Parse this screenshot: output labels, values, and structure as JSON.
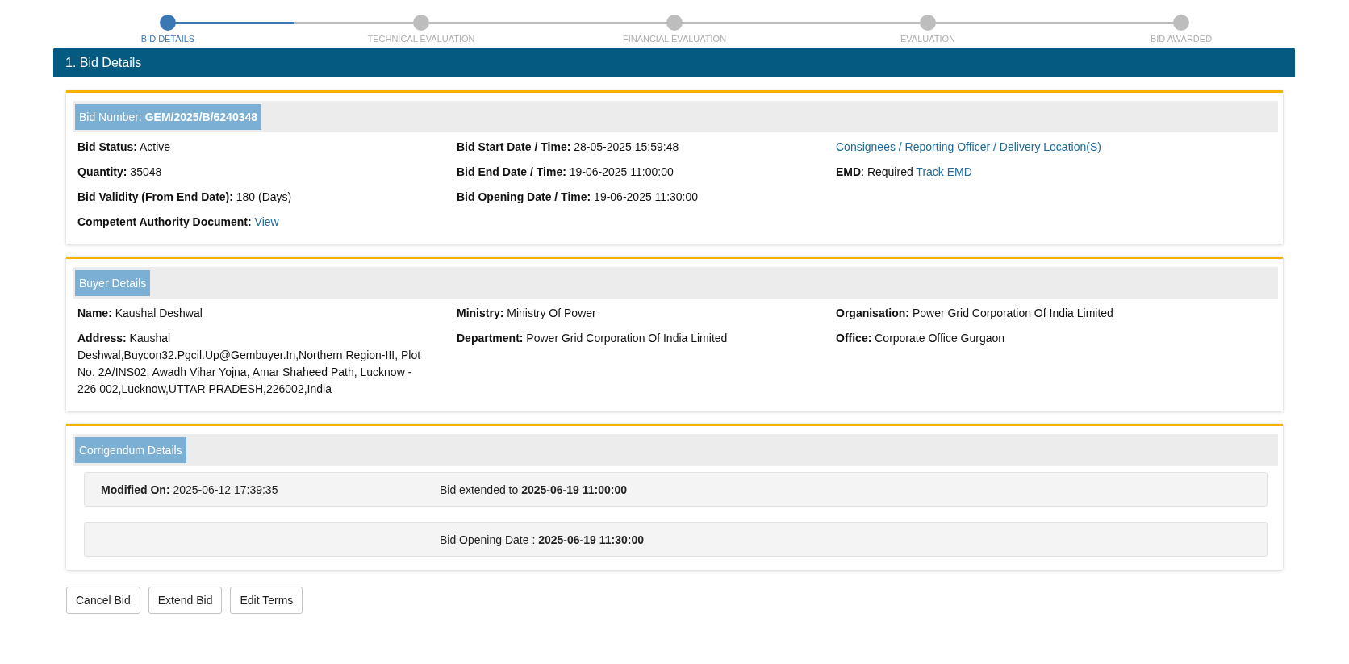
{
  "stepper": [
    {
      "label": "BID DETAILS",
      "selected": true
    },
    {
      "label": "TECHNICAL EVALUATION",
      "selected": false
    },
    {
      "label": "FINANCIAL EVALUATION",
      "selected": false
    },
    {
      "label": "EVALUATION",
      "selected": false
    },
    {
      "label": "BID AWARDED",
      "selected": false
    }
  ],
  "section_title": "1. Bid Details",
  "cards": [
    {
      "heading": "Bid Number: **GEM/2025/B/6240348**",
      "columns": [
        [
          {
            "text": "**Bid Status:** Active"
          },
          {
            "text": "**Quantity:** 35048"
          },
          {
            "text": "**Bid Validity (From End Date):** 180 (Days)"
          },
          {
            "text": "**Competent Authority Document:**",
            "link": "View"
          }
        ],
        [
          {
            "text": "**Bid Start Date / Time:** 28-05-2025 15:59:48"
          },
          {
            "text": "**Bid End Date / Time:** 19-06-2025 11:00:00"
          },
          {
            "text": "**Bid Opening Date / Time:** 19-06-2025 11:30:00"
          }
        ],
        [
          {
            "link": "Consignees / Reporting Officer / Delivery Location(S)"
          },
          {
            "text": "**EMD**: Required",
            "link": "Track EMD"
          }
        ]
      ]
    },
    {
      "heading": "Buyer Details",
      "columns": [
        [
          {
            "text": "**Name:** Kaushal Deshwal"
          },
          {
            "text": "**Address:** Kaushal Deshwal,Buycon32.Pgcil.Up@Gembuyer.In,Northern Region-III, Plot No. 2A/INS02, Awadh Vihar Yojna, Amar Shaheed Path, Lucknow - 226 002,Lucknow,UTTAR PRADESH,226002,India"
          }
        ],
        [
          {
            "text": "**Ministry:** Ministry Of Power"
          },
          {
            "text": "**Department:** Power Grid Corporation Of India Limited"
          }
        ],
        [
          {
            "text": "**Organisation:** Power Grid Corporation Of India Limited"
          },
          {
            "text": "**Office:** Corporate Office Gurgaon"
          }
        ]
      ]
    },
    {
      "heading": "Corrigendum Details",
      "rows": [
        {
          "left": "**Modified On:** 2025-06-12 17:39:35",
          "right": "Bid extended to **2025-06-19 11:00:00**"
        },
        {
          "right": "Bid Opening Date : **2025-06-19 11:30:00**"
        }
      ]
    }
  ],
  "buttons": [
    "Cancel Bid",
    "Extend Bid",
    "Edit Terms"
  ]
}
